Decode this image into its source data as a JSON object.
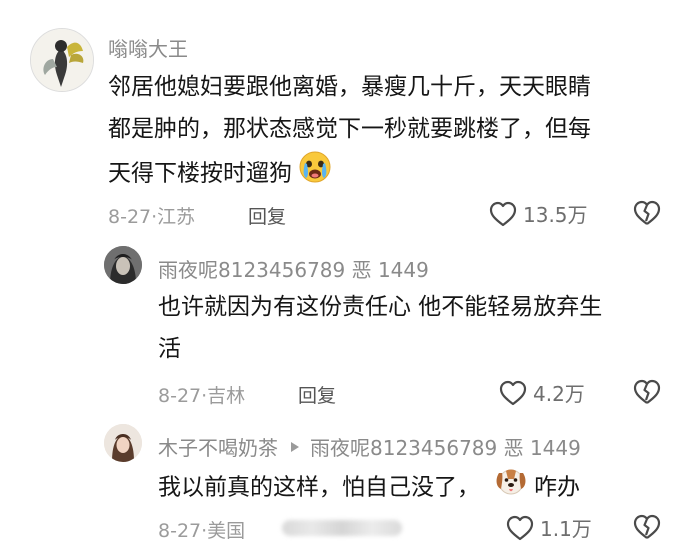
{
  "comments": [
    {
      "author": "嗡嗡大王",
      "text_lines": [
        "邻居他媳妇要跟他离婚，暴瘦几十斤，天天眼睛",
        "都是肿的，那状态感觉下一秒就要跳楼了，但每",
        "天得下楼按时遛狗"
      ],
      "date": "8-27",
      "location": "江苏",
      "reply_label": "回复",
      "likes": "13.5万"
    },
    {
      "author": "雨夜呢8123456789 恶 1449",
      "text_lines": [
        "也许就因为有这份责任心 他不能轻易放弃生",
        "活"
      ],
      "date": "8-27",
      "location": "吉林",
      "reply_label": "回复",
      "likes": "4.2万"
    },
    {
      "author": "木子不喝奶茶",
      "reply_to": "雨夜呢8123456789 恶 1449",
      "text": "我以前真的这样，怕自己没了，",
      "text_suffix": "咋办",
      "date": "8-27",
      "location": "美国",
      "likes": "1.1万"
    }
  ],
  "icons": {
    "like": "heart-outline-icon",
    "dislike": "broken-heart-icon",
    "emoji_cry": "crying-face-emoji",
    "emoji_dog": "dog-face-emoji",
    "reply_arrow": "triangle-right-icon"
  },
  "colors": {
    "text": "#161616",
    "meta": "#9b9b9b",
    "author": "#8a8a8a"
  }
}
